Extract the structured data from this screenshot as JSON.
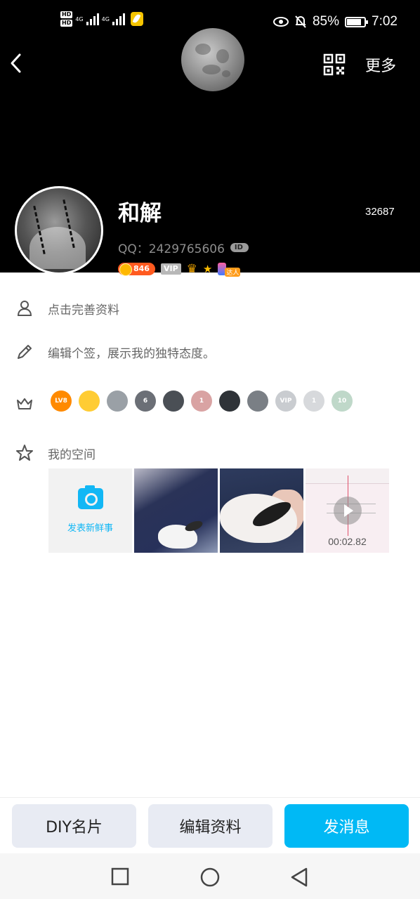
{
  "status_bar": {
    "net_1": "4G",
    "net_2": "4G",
    "hd_1": "HD",
    "hd_2": "HD",
    "battery": "85%",
    "time": "7:02"
  },
  "header": {
    "more_label": "更多"
  },
  "profile": {
    "nickname": "和解",
    "likes": "32687",
    "qq_label": "QQ：2429765606",
    "id_badge": "ID",
    "coin_level": "846",
    "vip_label": "VIP",
    "daren_label": "达人"
  },
  "info": {
    "complete_profile": "点击完善资料",
    "signature_hint": "编辑个签，展示我的独特态度。",
    "space_title": "我的空间"
  },
  "badges": [
    {
      "name": "lv8-badge",
      "label": "LV8",
      "color": "#ff8a00"
    },
    {
      "name": "heart-diamond-badge",
      "label": "",
      "color": "#ffcc33"
    },
    {
      "name": "silver-gem-badge",
      "label": "",
      "color": "#9aa0a6"
    },
    {
      "name": "penguin-badge-6",
      "label": "6",
      "color": "#6b6f76"
    },
    {
      "name": "penguin-crown-badge",
      "label": "",
      "color": "#4a4f55"
    },
    {
      "name": "diamond-badge-1",
      "label": "1",
      "color": "#d9a3a3"
    },
    {
      "name": "penguin-black-badge",
      "label": "",
      "color": "#2f3338"
    },
    {
      "name": "penguin-green-badge",
      "label": "",
      "color": "#7a7f85"
    },
    {
      "name": "vip-cloud-badge",
      "label": "VIP",
      "color": "#c9ccd0"
    },
    {
      "name": "suit-badge",
      "label": "1",
      "color": "#d7d9dc"
    },
    {
      "name": "gem-badge-10",
      "label": "10",
      "color": "#bfd8c9"
    }
  ],
  "gallery": {
    "post_label": "发表新鲜事",
    "voice_time": "00:02.82"
  },
  "actions": {
    "diy_card": "DIY名片",
    "edit_profile": "编辑资料",
    "send_message": "发消息"
  }
}
